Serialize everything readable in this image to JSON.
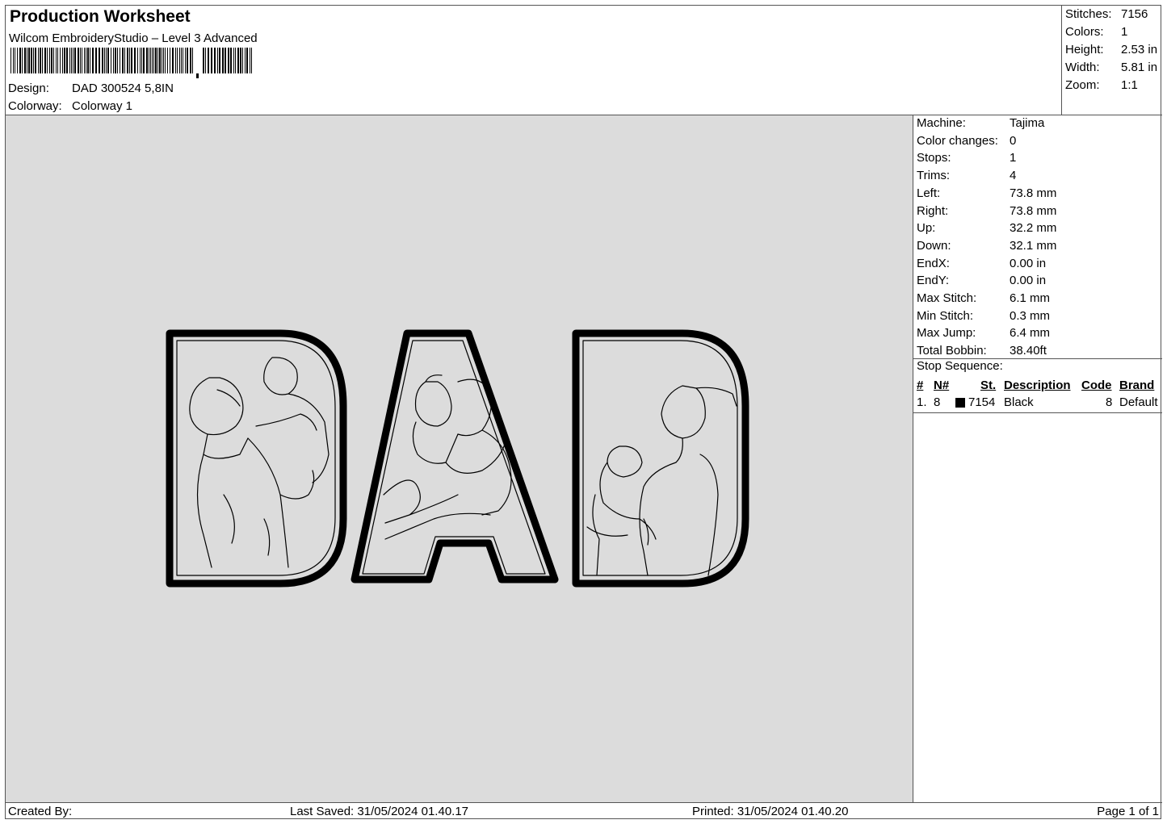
{
  "header": {
    "title": "Production Worksheet",
    "subtitle": "Wilcom EmbroideryStudio – Level 3 Advanced",
    "design_label": "Design:",
    "design_value": "DAD 300524 5,8IN",
    "colorway_label": "Colorway:",
    "colorway_value": "Colorway 1"
  },
  "summary": [
    {
      "k": "Stitches:",
      "v": "7156"
    },
    {
      "k": "Colors:",
      "v": "1"
    },
    {
      "k": "Height:",
      "v": "2.53 in"
    },
    {
      "k": "Width:",
      "v": "5.81 in"
    },
    {
      "k": "Zoom:",
      "v": "1:1"
    }
  ],
  "machine_info": [
    {
      "k": "Machine:",
      "v": "Tajima"
    },
    {
      "k": "Color changes:",
      "v": "0"
    },
    {
      "k": "Stops:",
      "v": "1"
    },
    {
      "k": "Trims:",
      "v": "4"
    },
    {
      "k": "Left:",
      "v": "73.8 mm"
    },
    {
      "k": "Right:",
      "v": "73.8 mm"
    },
    {
      "k": "Up:",
      "v": "32.2 mm"
    },
    {
      "k": "Down:",
      "v": "32.1 mm"
    },
    {
      "k": "EndX:",
      "v": "0.00 in"
    },
    {
      "k": "EndY:",
      "v": "0.00 in"
    },
    {
      "k": "Max Stitch:",
      "v": "6.1 mm"
    },
    {
      "k": "Min Stitch:",
      "v": "0.3 mm"
    },
    {
      "k": "Max Jump:",
      "v": "6.4 mm"
    },
    {
      "k": "Total Bobbin:",
      "v": "38.40ft"
    }
  ],
  "stop_sequence": {
    "label": "Stop Sequence:",
    "columns": [
      "#",
      "N#",
      "St.",
      "Description",
      "Code",
      "Brand"
    ],
    "rows": [
      {
        "num": "1.",
        "n": "8",
        "st": "7154",
        "description": "Black",
        "code": "8",
        "brand": "Default",
        "color": "#000000"
      }
    ]
  },
  "footer": {
    "created_by": "Created By:",
    "last_saved": "Last Saved: 31/05/2024 01.40.17",
    "printed": "Printed: 31/05/2024 01.40.20",
    "page": "Page 1 of 1"
  },
  "colors": {
    "preview_bg": "#dcdcdc",
    "thread": "#000000"
  }
}
